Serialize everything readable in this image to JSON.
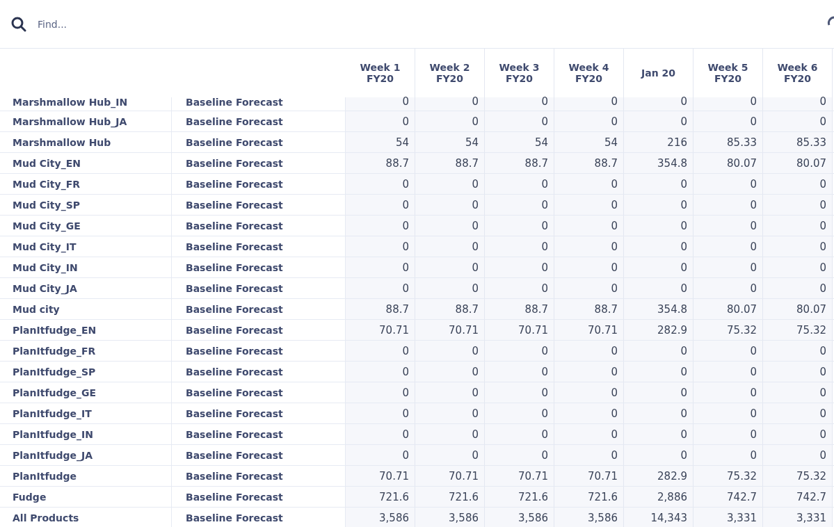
{
  "search": {
    "placeholder": "Find..."
  },
  "table": {
    "columns": [
      "Week 1 FY20",
      "Week 2 FY20",
      "Week 3 FY20",
      "Week 4 FY20",
      "Jan 20",
      "Week 5 FY20",
      "Week 6 FY20"
    ],
    "rows": [
      {
        "product": "Marshmallow Hub_IN",
        "measure": "Baseline Forecast",
        "values": [
          "0",
          "0",
          "0",
          "0",
          "0",
          "0",
          "0"
        ]
      },
      {
        "product": "Marshmallow Hub_JA",
        "measure": "Baseline Forecast",
        "values": [
          "0",
          "0",
          "0",
          "0",
          "0",
          "0",
          "0"
        ]
      },
      {
        "product": "Marshmallow Hub",
        "measure": "Baseline Forecast",
        "values": [
          "54",
          "54",
          "54",
          "54",
          "216",
          "85.33",
          "85.33"
        ]
      },
      {
        "product": "Mud City_EN",
        "measure": "Baseline Forecast",
        "values": [
          "88.7",
          "88.7",
          "88.7",
          "88.7",
          "354.8",
          "80.07",
          "80.07"
        ]
      },
      {
        "product": "Mud City_FR",
        "measure": "Baseline Forecast",
        "values": [
          "0",
          "0",
          "0",
          "0",
          "0",
          "0",
          "0"
        ]
      },
      {
        "product": "Mud City_SP",
        "measure": "Baseline Forecast",
        "values": [
          "0",
          "0",
          "0",
          "0",
          "0",
          "0",
          "0"
        ]
      },
      {
        "product": "Mud City_GE",
        "measure": "Baseline Forecast",
        "values": [
          "0",
          "0",
          "0",
          "0",
          "0",
          "0",
          "0"
        ]
      },
      {
        "product": "Mud City_IT",
        "measure": "Baseline Forecast",
        "values": [
          "0",
          "0",
          "0",
          "0",
          "0",
          "0",
          "0"
        ]
      },
      {
        "product": "Mud City_IN",
        "measure": "Baseline Forecast",
        "values": [
          "0",
          "0",
          "0",
          "0",
          "0",
          "0",
          "0"
        ]
      },
      {
        "product": "Mud City_JA",
        "measure": "Baseline Forecast",
        "values": [
          "0",
          "0",
          "0",
          "0",
          "0",
          "0",
          "0"
        ]
      },
      {
        "product": "Mud city",
        "measure": "Baseline Forecast",
        "values": [
          "88.7",
          "88.7",
          "88.7",
          "88.7",
          "354.8",
          "80.07",
          "80.07"
        ]
      },
      {
        "product": "PlanItfudge_EN",
        "measure": "Baseline Forecast",
        "values": [
          "70.71",
          "70.71",
          "70.71",
          "70.71",
          "282.9",
          "75.32",
          "75.32"
        ]
      },
      {
        "product": "PlanItfudge_FR",
        "measure": "Baseline Forecast",
        "values": [
          "0",
          "0",
          "0",
          "0",
          "0",
          "0",
          "0"
        ]
      },
      {
        "product": "PlanItfudge_SP",
        "measure": "Baseline Forecast",
        "values": [
          "0",
          "0",
          "0",
          "0",
          "0",
          "0",
          "0"
        ]
      },
      {
        "product": "PlanItfudge_GE",
        "measure": "Baseline Forecast",
        "values": [
          "0",
          "0",
          "0",
          "0",
          "0",
          "0",
          "0"
        ]
      },
      {
        "product": "PlanItfudge_IT",
        "measure": "Baseline Forecast",
        "values": [
          "0",
          "0",
          "0",
          "0",
          "0",
          "0",
          "0"
        ]
      },
      {
        "product": "PlanItfudge_IN",
        "measure": "Baseline Forecast",
        "values": [
          "0",
          "0",
          "0",
          "0",
          "0",
          "0",
          "0"
        ]
      },
      {
        "product": "PlanItfudge_JA",
        "measure": "Baseline Forecast",
        "values": [
          "0",
          "0",
          "0",
          "0",
          "0",
          "0",
          "0"
        ]
      },
      {
        "product": "PlanItfudge",
        "measure": "Baseline Forecast",
        "values": [
          "70.71",
          "70.71",
          "70.71",
          "70.71",
          "282.9",
          "75.32",
          "75.32"
        ]
      },
      {
        "product": "Fudge",
        "measure": "Baseline Forecast",
        "values": [
          "721.6",
          "721.6",
          "721.6",
          "721.6",
          "2,886",
          "742.7",
          "742.7"
        ]
      },
      {
        "product": "All Products",
        "measure": "Baseline Forecast",
        "values": [
          "3,586",
          "3,586",
          "3,586",
          "3,586",
          "14,343",
          "3,331",
          "3,331"
        ]
      }
    ]
  }
}
